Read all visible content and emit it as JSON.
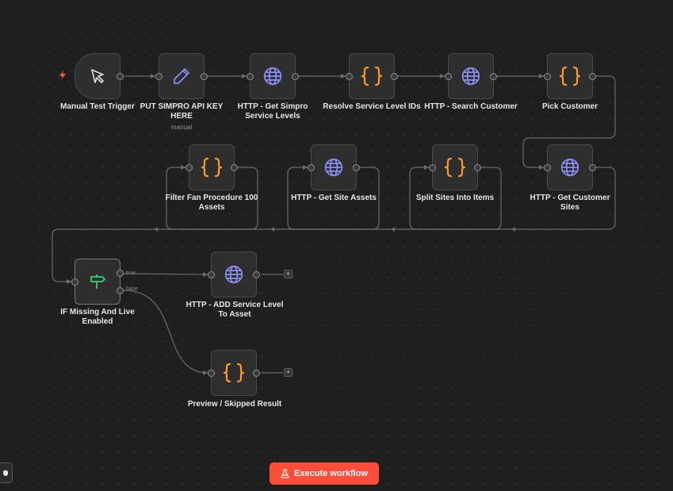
{
  "nodes": {
    "manual_trigger": {
      "label": "Manual Test Trigger",
      "icon": "cursor-icon"
    },
    "put_key": {
      "label": "PUT SIMPRO API KEY HERE",
      "sublabel": "manual",
      "icon": "pencil-icon"
    },
    "get_service_levels": {
      "label": "HTTP - Get Simpro Service Levels",
      "icon": "globe-icon"
    },
    "resolve_ids": {
      "label": "Resolve Service Level IDs",
      "icon": "code-braces-icon"
    },
    "search_customer": {
      "label": "HTTP - Search Customer",
      "icon": "globe-icon"
    },
    "pick_customer": {
      "label": "Pick Customer",
      "icon": "code-braces-icon"
    },
    "get_customer_sites": {
      "label": "HTTP - Get Customer Sites",
      "icon": "globe-icon"
    },
    "split_sites": {
      "label": "Split Sites Into Items",
      "icon": "code-braces-icon"
    },
    "get_site_assets": {
      "label": "HTTP - Get Site Assets",
      "icon": "globe-icon"
    },
    "filter_fan": {
      "label": "Filter Fan Procedure 100 Assets",
      "icon": "code-braces-icon"
    },
    "if_missing": {
      "label": "IF Missing And Live Enabled",
      "icon": "signpost-icon",
      "branch_true": "true",
      "branch_false": "false"
    },
    "add_service_level": {
      "label": "HTTP - ADD Service Level To Asset",
      "icon": "globe-icon"
    },
    "preview": {
      "label": "Preview / Skipped Result",
      "icon": "code-braces-icon"
    }
  },
  "add_symbol": "+",
  "execute": {
    "label": "Execute workflow",
    "icon": "flask-icon"
  },
  "colors": {
    "accent": "#ff4d3a",
    "code": "#ff9b26",
    "http": "#8b8ef5",
    "pencil": "#8b8ef5",
    "if": "#3ecf6e"
  }
}
